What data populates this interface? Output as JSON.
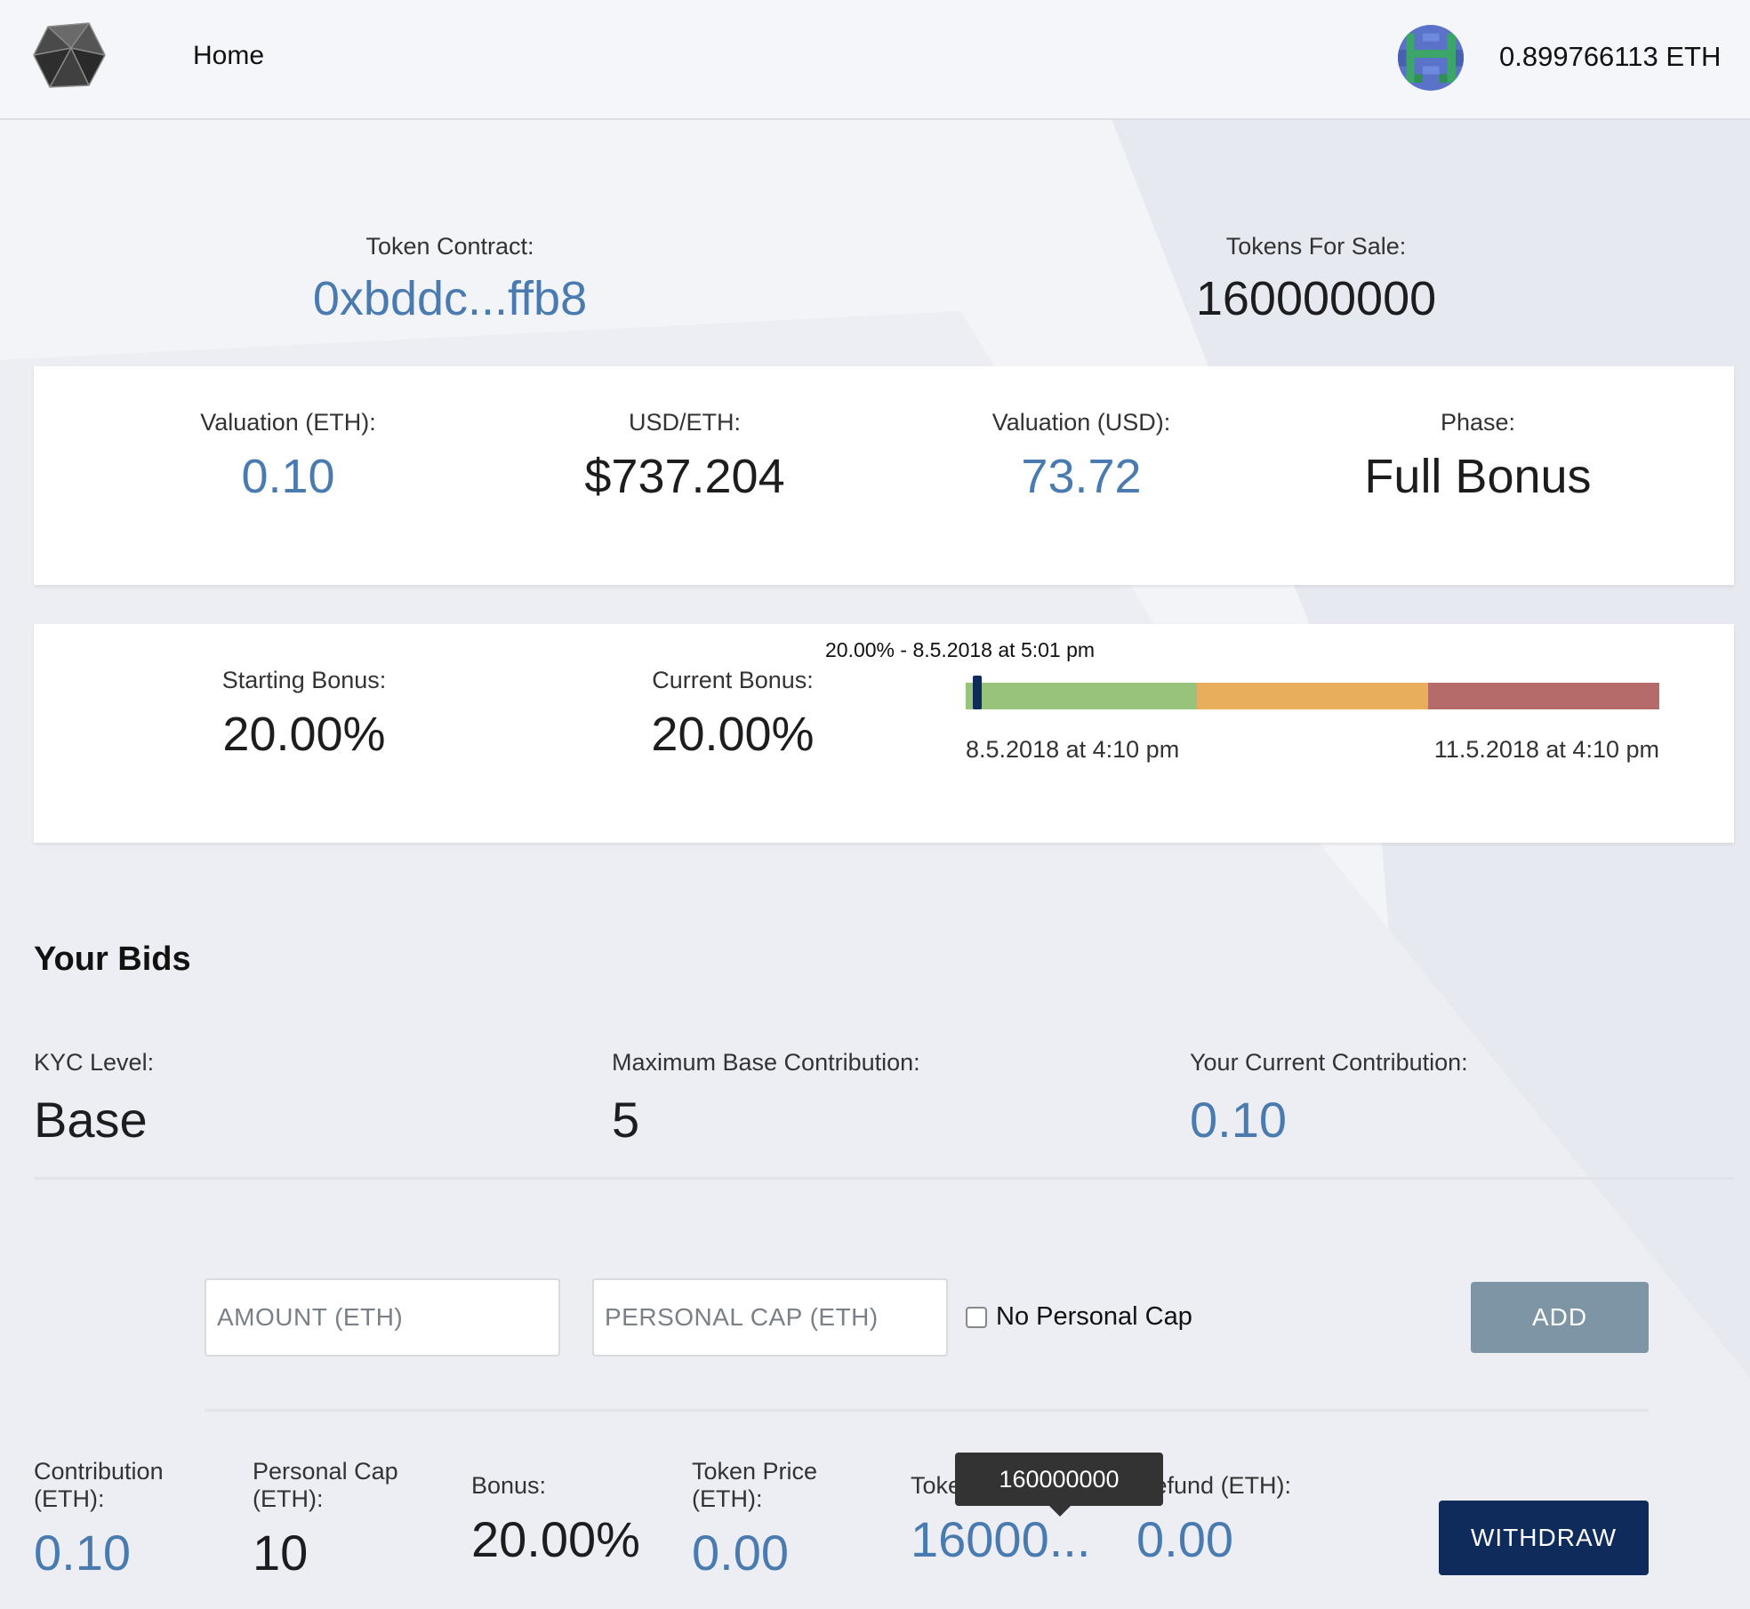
{
  "header": {
    "nav_home": "Home",
    "balance": "0.899766113 ETH"
  },
  "summary": {
    "token_contract_label": "Token Contract:",
    "token_contract_value": "0xbddc...ffb8",
    "tokens_for_sale_label": "Tokens For Sale:",
    "tokens_for_sale_value": "160000000"
  },
  "valuation_card": {
    "valuation_eth_label": "Valuation (ETH):",
    "valuation_eth_value": "0.10",
    "usd_eth_label": "USD/ETH:",
    "usd_eth_value": "$737.204",
    "valuation_usd_label": "Valuation (USD):",
    "valuation_usd_value": "73.72",
    "phase_label": "Phase:",
    "phase_value": "Full Bonus"
  },
  "bonus_card": {
    "starting_bonus_label": "Starting Bonus:",
    "starting_bonus_value": "20.00%",
    "current_bonus_label": "Current Bonus:",
    "current_bonus_value": "20.00%",
    "timeline_marker_label": "20.00% - 8.5.2018 at 5:01 pm",
    "timeline_start": "8.5.2018 at 4:10 pm",
    "timeline_end": "11.5.2018 at 4:10 pm",
    "timeline_progress": 0.01,
    "timeline_colors": [
      "#97c47a",
      "#e9ae5c",
      "#b56b69"
    ]
  },
  "bids": {
    "title": "Your Bids",
    "kyc_label": "KYC Level:",
    "kyc_value": "Base",
    "max_contrib_label": "Maximum Base Contribution:",
    "max_contrib_value": "5",
    "current_contrib_label": "Your Current Contribution:",
    "current_contrib_value": "0.10"
  },
  "form": {
    "amount_placeholder": "AMOUNT (ETH)",
    "personal_cap_placeholder": "PERSONAL CAP (ETH)",
    "no_cap_label": "No Personal Cap",
    "add_label": "ADD"
  },
  "bid_row": {
    "contribution_label_1": "Contribution",
    "contribution_label_2": "(ETH):",
    "contribution_value": "0.10",
    "personal_cap_label_1": "Personal Cap",
    "personal_cap_label_2": "(ETH):",
    "personal_cap_value": "10",
    "bonus_label": "Bonus:",
    "bonus_value": "20.00%",
    "token_price_label_1": "Token Price",
    "token_price_label_2": "(ETH):",
    "token_price_value": "0.00",
    "tokens_label": "Tokens:",
    "tokens_value": "16000...",
    "tokens_tooltip": "160000000",
    "refund_label": "Refund (ETH):",
    "refund_value": "0.00",
    "withdraw_label": "WITHDRAW"
  }
}
